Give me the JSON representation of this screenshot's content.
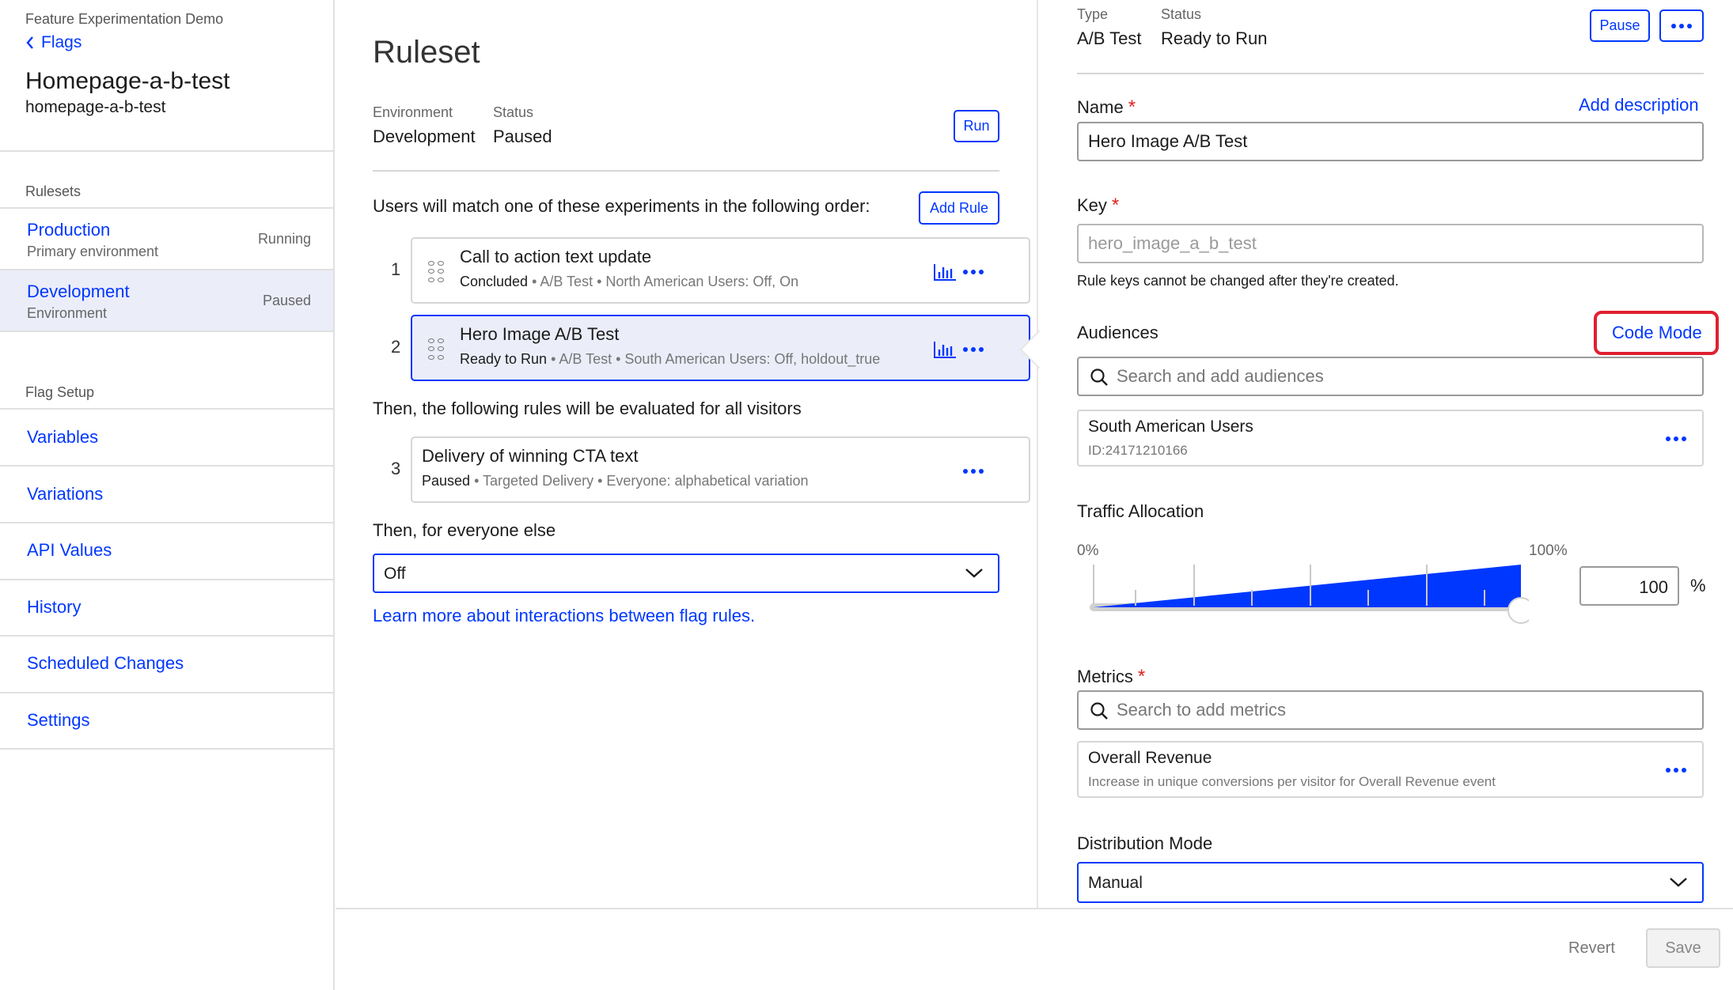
{
  "sidebar": {
    "project": "Feature Experimentation Demo",
    "back_label": "Flags",
    "flag_name": "Homepage-a-b-test",
    "flag_key": "homepage-a-b-test",
    "rulesets_heading": "Rulesets",
    "environments": [
      {
        "name": "Production",
        "sub": "Primary environment",
        "status": "Running"
      },
      {
        "name": "Development",
        "sub": "Environment",
        "status": "Paused"
      }
    ],
    "flag_setup_heading": "Flag Setup",
    "links": [
      "Variables",
      "Variations",
      "API Values",
      "History",
      "Scheduled Changes",
      "Settings"
    ]
  },
  "ruleset": {
    "title": "Ruleset",
    "env_label": "Environment",
    "env_value": "Development",
    "status_label": "Status",
    "status_value": "Paused",
    "run_label": "Run",
    "match_text": "Users will match one of these experiments in the following order:",
    "add_rule_label": "Add Rule",
    "rules": [
      {
        "num": "1",
        "title": "Call to action text update",
        "status": "Concluded",
        "meta": " • A/B Test • North American Users: Off, On"
      },
      {
        "num": "2",
        "title": "Hero Image A/B Test",
        "status": "Ready to Run",
        "meta": " • A/B Test • South American Users: Off, holdout_true"
      },
      {
        "num": "3",
        "title": "Delivery of winning CTA text",
        "status": "Paused",
        "meta": " • Targeted Delivery • Everyone: alphabetical variation"
      }
    ],
    "then_all_text": "Then, the following rules will be evaluated for all visitors",
    "then_else_text": "Then, for everyone else",
    "fallback_value": "Off",
    "learn_more": "Learn more about interactions between flag rules."
  },
  "detail": {
    "type_label": "Type",
    "type_value": "A/B Test",
    "status_label": "Status",
    "status_value": "Ready to Run",
    "pause_label": "Pause",
    "name_label": "Name",
    "add_description": "Add description",
    "name_value": "Hero Image A/B Test",
    "key_label": "Key",
    "key_placeholder": "hero_image_a_b_test",
    "key_help": "Rule keys cannot be changed after they're created.",
    "audiences_label": "Audiences",
    "code_mode": "Code Mode",
    "audience_search_placeholder": "Search and add audiences",
    "audience": {
      "name": "South American Users",
      "id": "ID:24171210166"
    },
    "traffic_label": "Traffic Allocation",
    "traffic_min": "0%",
    "traffic_max": "100%",
    "traffic_value": "100",
    "traffic_fraction": 1.0,
    "percent_sign": "%",
    "metrics_label": "Metrics",
    "metrics_search_placeholder": "Search to add metrics",
    "metric": {
      "name": "Overall Revenue",
      "desc": "Increase in unique conversions per visitor for Overall Revenue event"
    },
    "distribution_label": "Distribution Mode",
    "distribution_value": "Manual"
  },
  "footer": {
    "revert": "Revert",
    "save": "Save"
  },
  "colors": {
    "accent": "#0037ff",
    "highlight": "#e02030",
    "selected_bg": "#ebedf9"
  }
}
